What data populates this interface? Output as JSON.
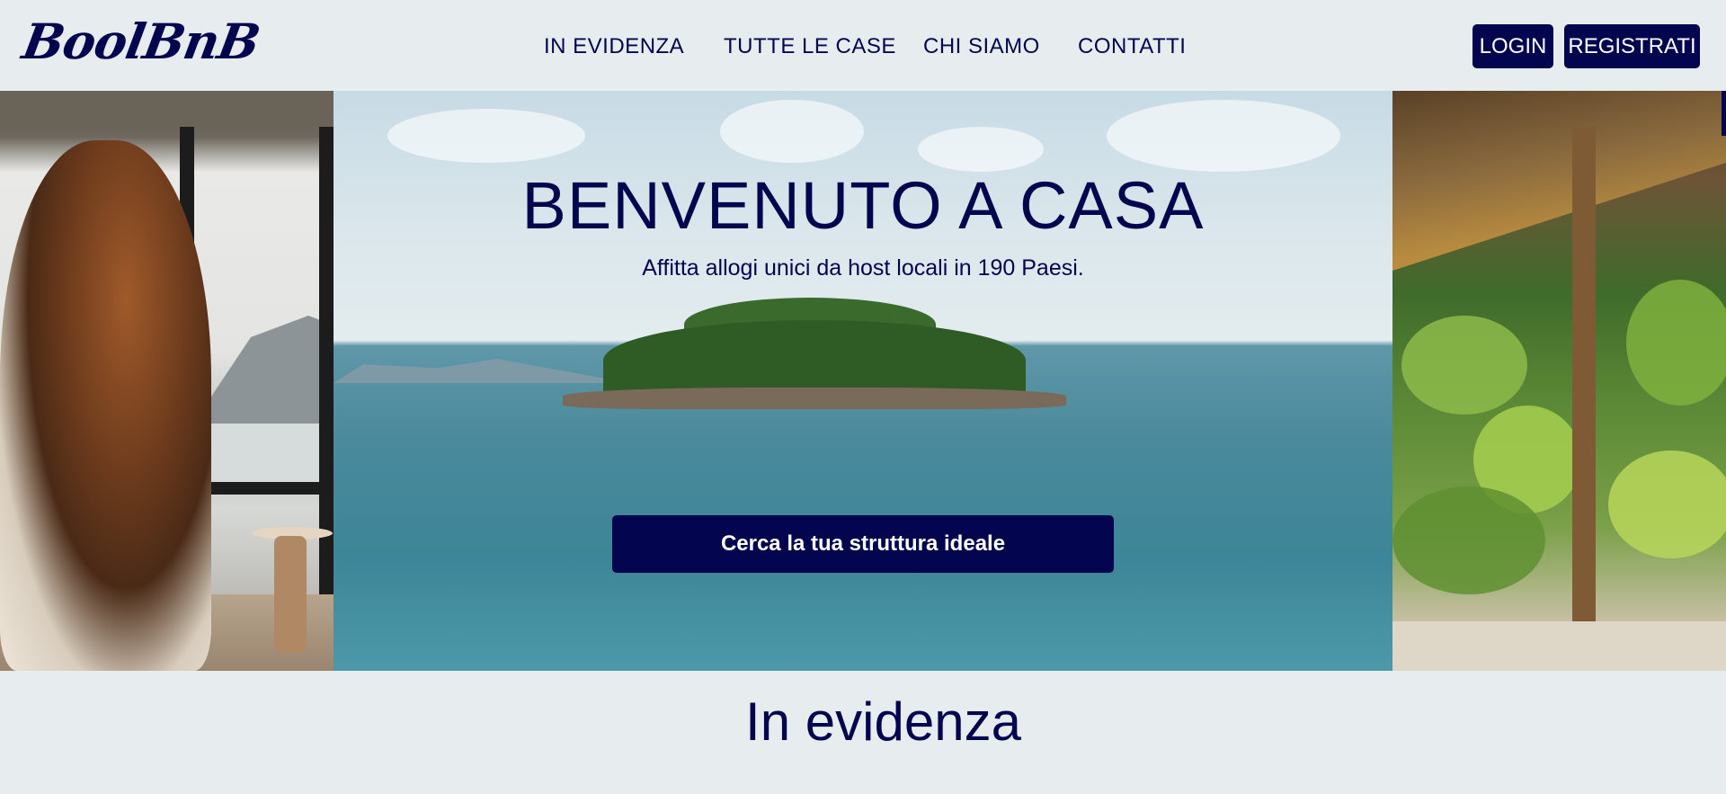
{
  "header": {
    "logo": "BoolBnB",
    "nav": [
      {
        "label": "IN EVIDENZA"
      },
      {
        "label": "TUTTE LE CASE"
      },
      {
        "label": "CHI SIAMO"
      },
      {
        "label": "CONTATTI"
      }
    ],
    "login_label": "LOGIN",
    "register_label": "REGISTRATI"
  },
  "hero": {
    "title": "BENVENUTO A CASA",
    "subtitle": "Affitta allogi unici da host locali in 190 Paesi.",
    "cta_label": "Cerca la tua struttura ideale"
  },
  "featured": {
    "title": "In evidenza"
  },
  "colors": {
    "brand": "#04054f",
    "background": "#e7ecef",
    "button_text": "#ffffff"
  }
}
